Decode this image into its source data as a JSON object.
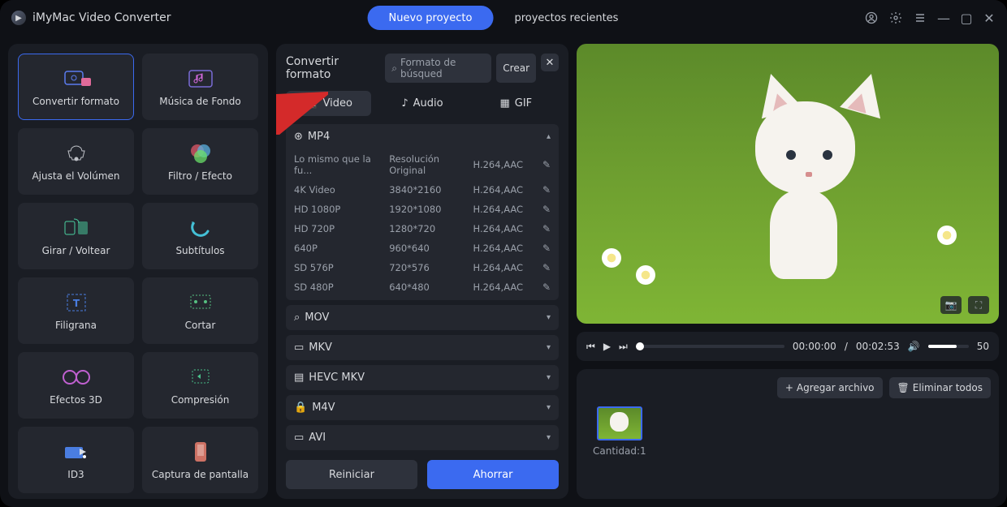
{
  "title": "iMyMac Video Converter",
  "header": {
    "new_project": "Nuevo proyecto",
    "recent_projects": "proyectos recientes"
  },
  "tools": [
    {
      "label": "Convertir formato",
      "name": "convert-format",
      "active": true
    },
    {
      "label": "Música de Fondo",
      "name": "background-music"
    },
    {
      "label": "Ajusta el Volúmen",
      "name": "adjust-volume"
    },
    {
      "label": "Filtro / Efecto",
      "name": "filter-effect"
    },
    {
      "label": "Girar / Voltear",
      "name": "rotate-flip"
    },
    {
      "label": "Subtítulos",
      "name": "subtitles"
    },
    {
      "label": "Filigrana",
      "name": "watermark"
    },
    {
      "label": "Cortar",
      "name": "cut"
    },
    {
      "label": "Efectos 3D",
      "name": "3d-effects"
    },
    {
      "label": "Compresión",
      "name": "compression"
    },
    {
      "label": "ID3",
      "name": "id3"
    },
    {
      "label": "Captura de pantalla",
      "name": "screenshot"
    }
  ],
  "center": {
    "title": "Convertir formato",
    "search_placeholder": "Formato de búsqued",
    "create": "Crear",
    "tabs": {
      "video": "Video",
      "audio": "Audio",
      "gif": "GIF"
    },
    "expanded": {
      "name": "MP4",
      "rows": [
        {
          "label": "Lo mismo que la fu...",
          "res": "Resolución Original",
          "codec": "H.264,AAC"
        },
        {
          "label": "4K Video",
          "res": "3840*2160",
          "codec": "H.264,AAC"
        },
        {
          "label": "HD 1080P",
          "res": "1920*1080",
          "codec": "H.264,AAC"
        },
        {
          "label": "HD 720P",
          "res": "1280*720",
          "codec": "H.264,AAC"
        },
        {
          "label": "640P",
          "res": "960*640",
          "codec": "H.264,AAC"
        },
        {
          "label": "SD 576P",
          "res": "720*576",
          "codec": "H.264,AAC"
        },
        {
          "label": "SD 480P",
          "res": "640*480",
          "codec": "H.264,AAC"
        }
      ]
    },
    "collapsed": [
      "MOV",
      "MKV",
      "HEVC MKV",
      "M4V",
      "AVI"
    ],
    "reset": "Reiniciar",
    "save": "Ahorrar"
  },
  "playback": {
    "current": "00:00:00",
    "total": "00:02:53",
    "volume": "50"
  },
  "files": {
    "add": "Agregar archivo",
    "remove_all": "Eliminar todos",
    "count_label": "Cantidad:",
    "count": "1"
  }
}
